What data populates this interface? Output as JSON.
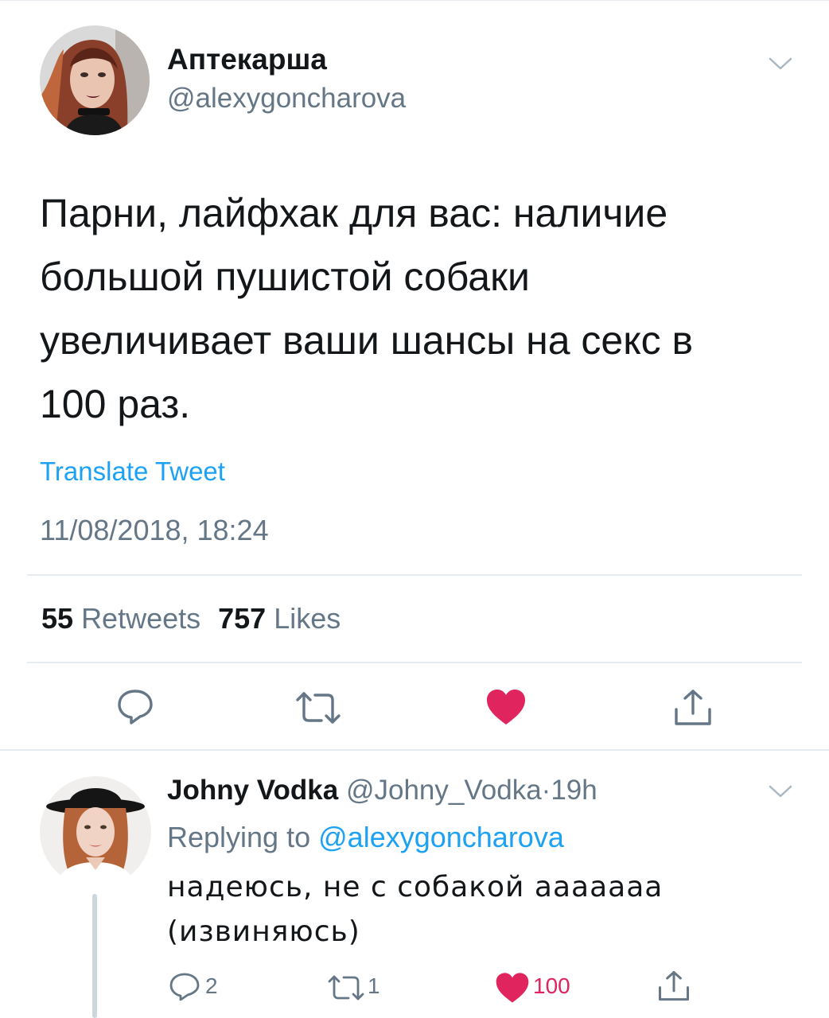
{
  "tweet": {
    "author": {
      "display_name": "Аптекарша",
      "handle": "@alexygoncharova"
    },
    "text_lines": [
      "Парни, лайфхак для вас: наличие",
      "большой пушистой собаки",
      "увеличивает ваши шансы на секс в",
      "100 раз."
    ],
    "translate_label": "Translate Tweet",
    "timestamp": "11/08/2018, 18:24",
    "stats": {
      "retweets_count": "55",
      "retweets_label": "Retweets",
      "likes_count": "757",
      "likes_label": "Likes"
    },
    "actions": [
      "reply-icon",
      "retweet-icon",
      "like-icon-filled",
      "share-icon"
    ]
  },
  "reply": {
    "display_name": "Johny Vodka",
    "handle": "@Johny_Vodka",
    "separator": "·",
    "time": "19h",
    "replying_prefix": "Replying to",
    "replying_to": "@alexygoncharova",
    "text_lines": [
      "надеюсь, не с собакой ааааааа",
      "(извиняюсь)"
    ],
    "counts": {
      "replies": "2",
      "retweets": "1",
      "likes": "100"
    }
  },
  "colors": {
    "accent": "#1da1f2",
    "like": "#e0245e",
    "secondary_text": "#657786",
    "divider": "#e6ecf0"
  }
}
